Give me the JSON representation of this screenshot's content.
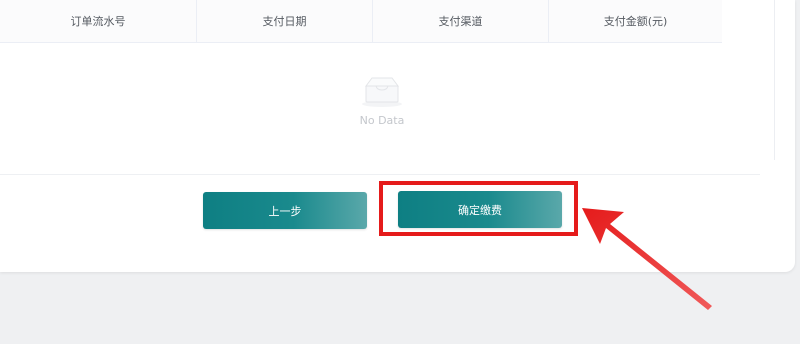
{
  "table": {
    "headers": [
      "订单流水号",
      "支付日期",
      "支付渠道",
      "支付金额(元)"
    ]
  },
  "empty_state": {
    "text": "No Data",
    "icon": "empty-box-icon"
  },
  "actions": {
    "prev_label": "上一步",
    "confirm_label": "确定缴费"
  },
  "colors": {
    "button_primary": "#0e7f83",
    "button_gradient_end": "#5aa8aa",
    "annotation": "#e51b1b",
    "header_background": "#fbfbfc"
  }
}
